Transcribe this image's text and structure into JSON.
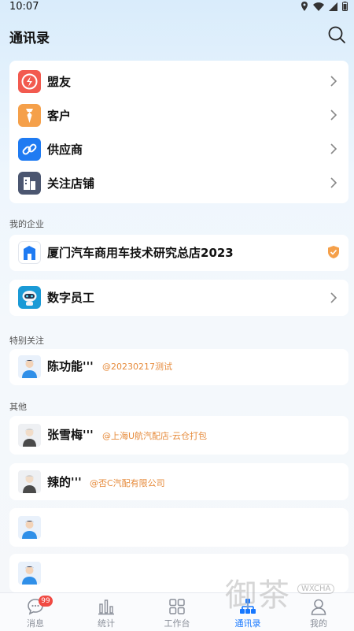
{
  "status": {
    "time": "10:07"
  },
  "header": {
    "title": "通讯录"
  },
  "quick_links": [
    {
      "label": "盟友"
    },
    {
      "label": "客户"
    },
    {
      "label": "供应商"
    },
    {
      "label": "关注店铺"
    }
  ],
  "my_company": {
    "section_label": "我的企业",
    "company_name": "厦门汽车商用车技术研究总店2023",
    "digital_staff": "数字员工"
  },
  "special_follow": {
    "section_label": "特别关注",
    "people": [
      {
        "name": "陈功能'''",
        "org": "@20230217测试"
      }
    ]
  },
  "others": {
    "section_label": "其他",
    "people": [
      {
        "name": "张雪梅'''",
        "org": "@上海U航汽配店-云仓打包"
      },
      {
        "name": "辣的'''",
        "org": "@否C汽配有限公司"
      },
      {
        "name": "",
        "org": ""
      },
      {
        "name": "",
        "org": ""
      }
    ]
  },
  "tabbar": {
    "messages": "消息",
    "messages_badge": "99",
    "stats": "统计",
    "workbench": "工作台",
    "contacts": "通讯录",
    "me": "我的"
  },
  "watermark": {
    "text": "御茶",
    "sub": "WXCHA"
  },
  "colors": {
    "accent": "#1677ff",
    "org_text": "#e68a3a",
    "badge": "#f04a43"
  }
}
